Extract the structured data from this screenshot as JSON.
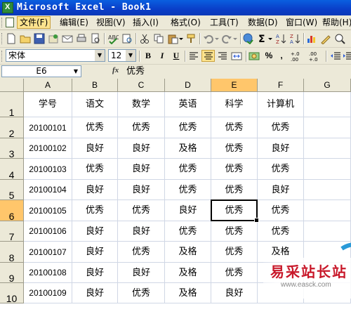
{
  "window": {
    "title": "Microsoft Excel - Book1"
  },
  "menu": [
    "文件(F)",
    "编辑(E)",
    "视图(V)",
    "插入(I)",
    "格式(O)",
    "工具(T)",
    "数据(D)",
    "窗口(W)",
    "帮助(H)"
  ],
  "format_toolbar": {
    "font_name": "宋体",
    "font_size": "12",
    "bold": "B",
    "italic": "I",
    "underline": "U",
    "percent": "%",
    "comma": ",",
    "inc_decimal": "+.0\n.00",
    "dec_decimal": ".00\n+.0"
  },
  "formula_bar": {
    "cell_ref": "E6",
    "fx": "fx",
    "value": "优秀"
  },
  "columns": [
    "A",
    "B",
    "C",
    "D",
    "E",
    "F",
    "G"
  ],
  "rows": [
    {
      "num": "1",
      "cells": [
        "学号",
        "语文",
        "数学",
        "英语",
        "科学",
        "计算机",
        ""
      ]
    },
    {
      "num": "2",
      "cells": [
        "20100101",
        "优秀",
        "优秀",
        "优秀",
        "优秀",
        "优秀",
        ""
      ]
    },
    {
      "num": "3",
      "cells": [
        "20100102",
        "良好",
        "良好",
        "及格",
        "优秀",
        "良好",
        ""
      ]
    },
    {
      "num": "4",
      "cells": [
        "20100103",
        "优秀",
        "良好",
        "优秀",
        "优秀",
        "优秀",
        ""
      ]
    },
    {
      "num": "5",
      "cells": [
        "20100104",
        "良好",
        "良好",
        "优秀",
        "优秀",
        "良好",
        ""
      ]
    },
    {
      "num": "6",
      "cells": [
        "20100105",
        "优秀",
        "优秀",
        "良好",
        "优秀",
        "优秀",
        ""
      ]
    },
    {
      "num": "7",
      "cells": [
        "20100106",
        "良好",
        "良好",
        "优秀",
        "优秀",
        "优秀",
        ""
      ]
    },
    {
      "num": "8",
      "cells": [
        "20100107",
        "良好",
        "优秀",
        "及格",
        "优秀",
        "及格",
        ""
      ]
    },
    {
      "num": "9",
      "cells": [
        "20100108",
        "良好",
        "良好",
        "及格",
        "优秀",
        "",
        ""
      ]
    },
    {
      "num": "10",
      "cells": [
        "20100109",
        "良好",
        "优秀",
        "及格",
        "良好",
        "",
        ""
      ]
    }
  ],
  "selection": {
    "cell": "E6"
  },
  "watermark": {
    "text": "易采站长站",
    "url": "www.easck.com"
  }
}
